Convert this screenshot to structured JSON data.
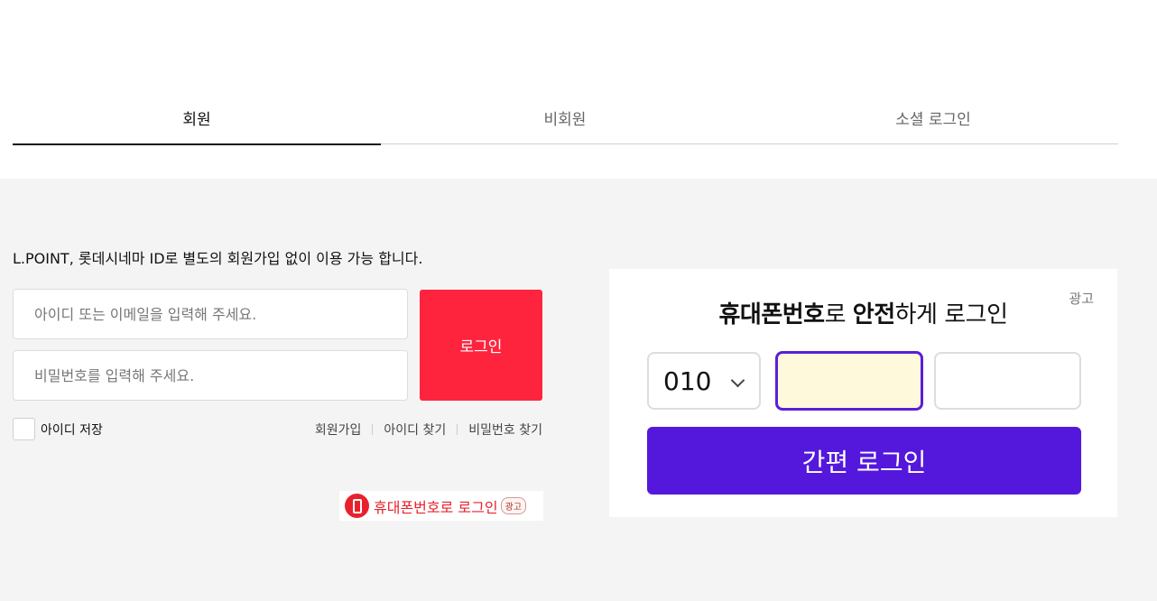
{
  "tabs": [
    {
      "label": "회원",
      "active": true
    },
    {
      "label": "비회원",
      "active": false
    },
    {
      "label": "소셜 로그인",
      "active": false
    }
  ],
  "login": {
    "notice": "L.POINT, 롯데시네마 ID로 별도의 회원가입 없이 이용 가능 합니다.",
    "id_placeholder": "아이디 또는 이메일을 입력해 주세요.",
    "pw_placeholder": "비밀번호를 입력해 주세요.",
    "login_button": "로그인",
    "save_id_label": "아이디 저장",
    "links": [
      "회원가입",
      "아이디 찾기",
      "비밀번호 찾기"
    ]
  },
  "small_ad": {
    "text": "휴대폰번호로 로그인",
    "badge": "광고"
  },
  "phone_panel": {
    "ad_label": "광고",
    "title_part1": "휴대폰번호",
    "title_part2": "로 ",
    "title_part3": "안전",
    "title_part4": "하게 로그인",
    "prefix": "010",
    "button": "간편 로그인"
  },
  "colors": {
    "primary_red": "#ff243e",
    "ad_purple": "#5418dd",
    "focus_fill": "#fff9dc"
  }
}
